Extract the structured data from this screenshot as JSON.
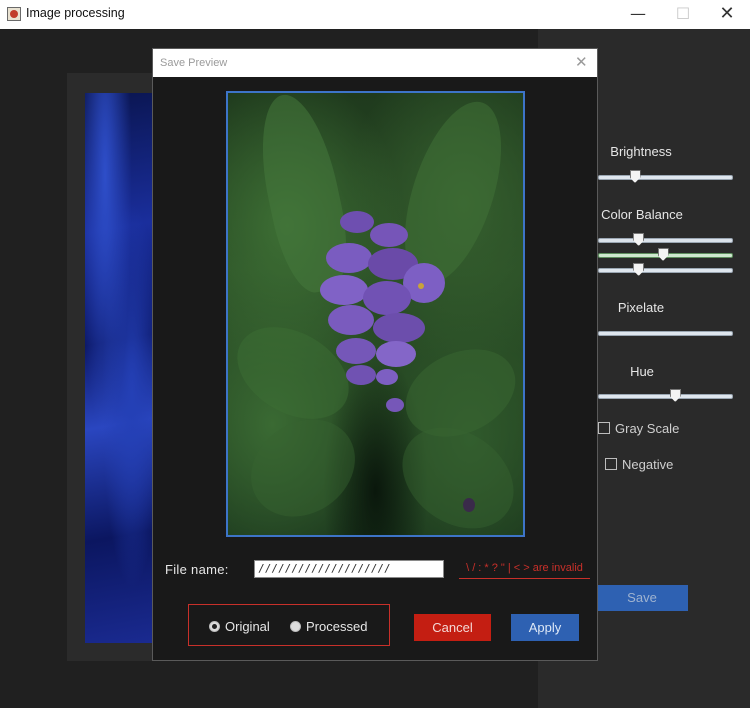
{
  "window": {
    "title": "Image processing",
    "minimize_glyph": "—",
    "maximize_glyph": "☐",
    "close_glyph": "✕"
  },
  "controls": {
    "brightness": {
      "label": "Brightness",
      "value": 0.25
    },
    "color_balance": {
      "label": "Color Balance",
      "channels": [
        {
          "name": "red",
          "value": 0.28
        },
        {
          "name": "green",
          "value": 0.48
        },
        {
          "name": "blue",
          "value": 0.28
        }
      ]
    },
    "pixelate": {
      "label": "Pixelate",
      "value": 0
    },
    "hue": {
      "label": "Hue",
      "value": 0.58
    },
    "gray_scale": {
      "label": "Gray Scale",
      "checked": false
    },
    "negative": {
      "label": "Negative",
      "checked": false
    },
    "save_label": "Save"
  },
  "dialog": {
    "title": "Save Preview",
    "close_glyph": "✕",
    "file_name_label": "File name:",
    "file_name_value": "////////////////////",
    "invalid_message": "\\ / : * ? \" | < > are invalid",
    "options": [
      {
        "label": "Original",
        "selected": true
      },
      {
        "label": "Processed",
        "selected": false
      }
    ],
    "cancel_label": "Cancel",
    "apply_label": "Apply"
  },
  "colors": {
    "accent_blue": "#2e61b2",
    "cancel_red": "#c41e12",
    "error_red": "#c8302a"
  }
}
